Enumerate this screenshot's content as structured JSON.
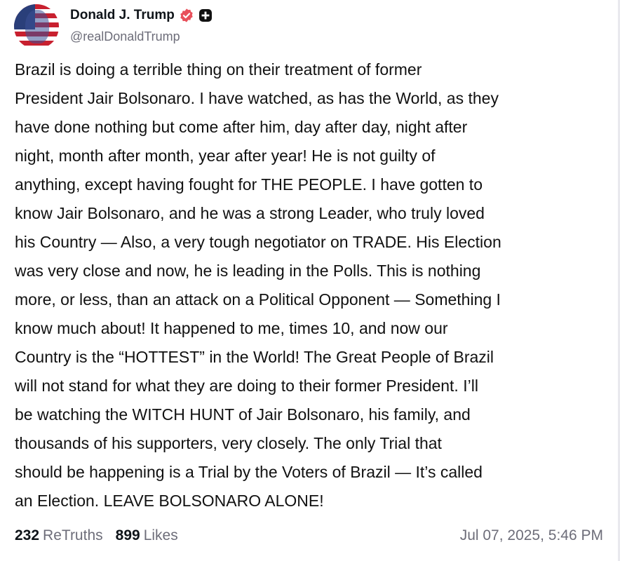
{
  "author": {
    "display_name": "Donald J. Trump",
    "handle": "@realDonaldTrump",
    "verified_icon": "verified-badge-icon",
    "extra_icon": "plus-badge-icon",
    "verified_color": "#e8505b"
  },
  "post": {
    "lines": [
      "Brazil is doing a terrible thing on their treatment of former",
      "President Jair Bolsonaro. I have watched, as has the World, as they",
      "have done nothing but come after him, day after day, night after",
      "night, month after month, year after year! He is not guilty of",
      "anything, except having fought for THE PEOPLE. I have gotten to",
      "know Jair Bolsonaro, and he was a strong Leader, who truly loved",
      "his Country — Also, a very tough negotiator on TRADE. His Election",
      "was very close and now, he is leading in the Polls. This is nothing",
      "more, or less, than an attack on a Political Opponent — Something I",
      "know much about! It happened to me, times 10, and now our",
      "Country is the “HOTTEST” in the World! The Great People of Brazil",
      "will not stand for what they are doing to their former President. I’ll",
      "be watching the WITCH HUNT of Jair Bolsonaro, his family, and",
      "thousands of his supporters, very closely. The only Trial that",
      "should be happening is a Trial by the Voters of Brazil — It’s called",
      "an Election. LEAVE BOLSONARO ALONE!"
    ]
  },
  "stats": {
    "retruths_count": "232",
    "retruths_label": "ReTruths",
    "likes_count": "899",
    "likes_label": "Likes"
  },
  "timestamp": "Jul 07, 2025, 5:46 PM"
}
